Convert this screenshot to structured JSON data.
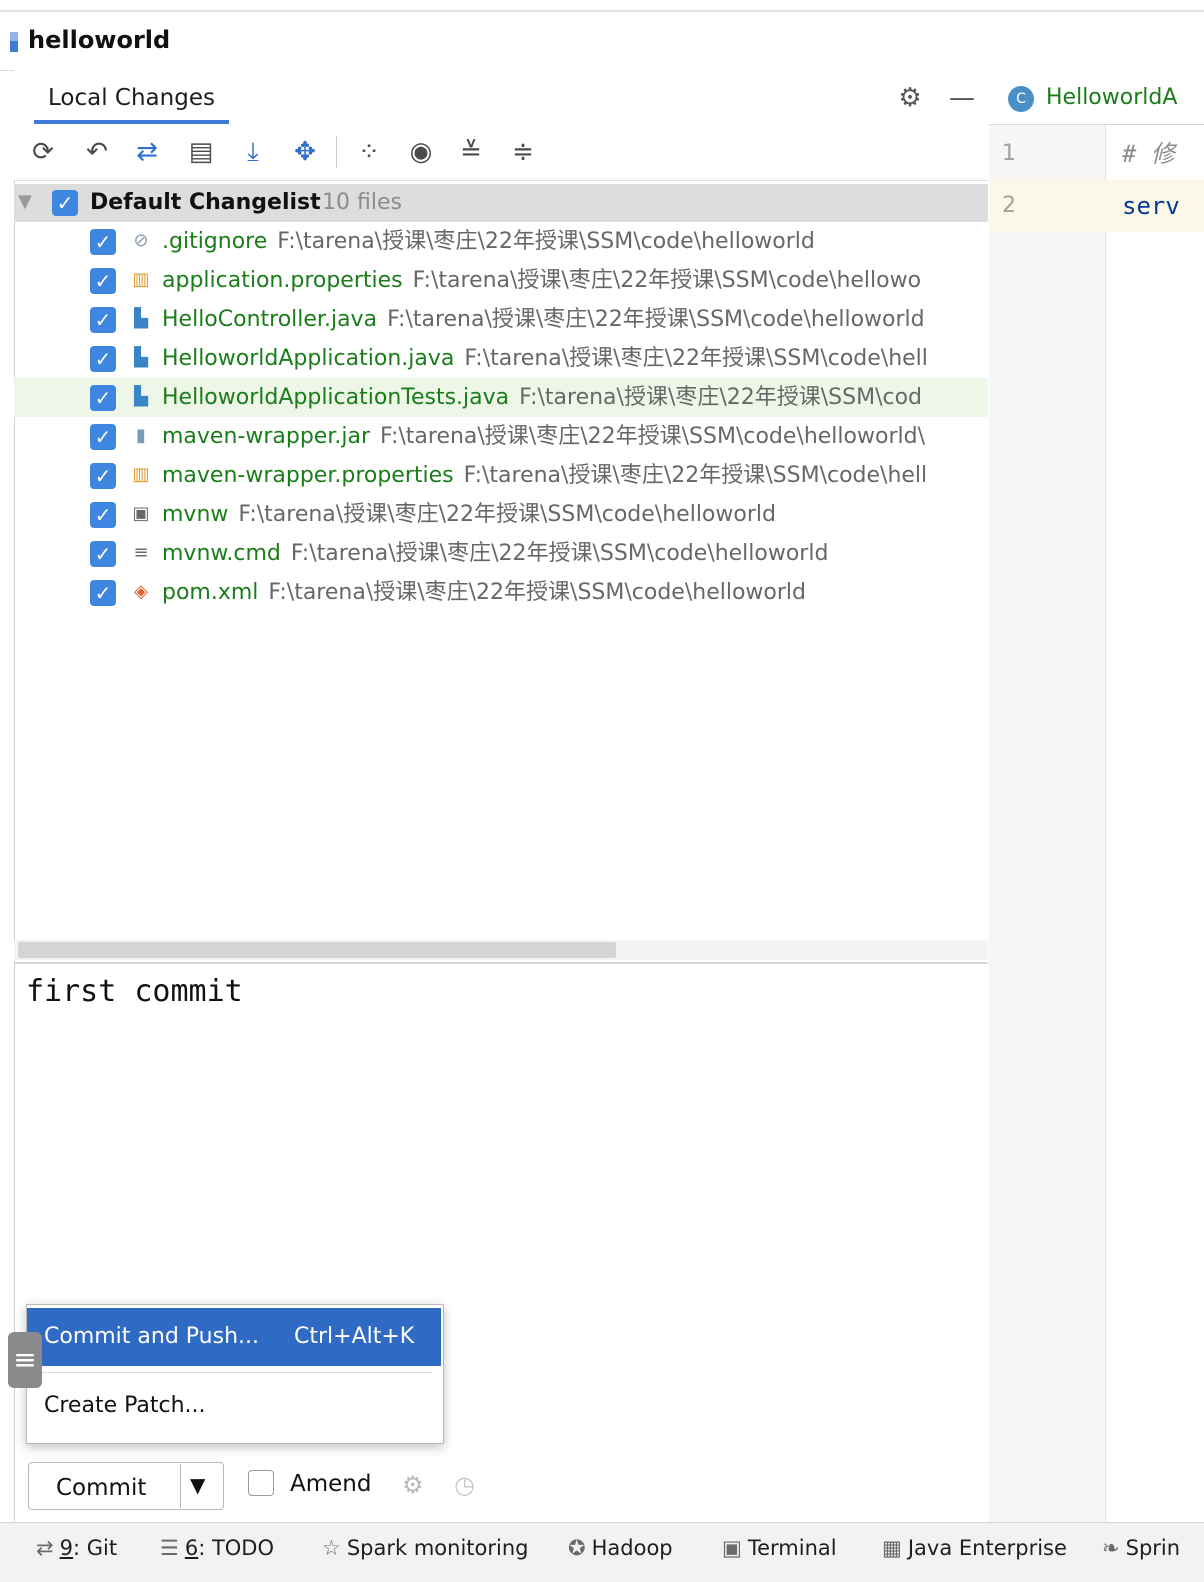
{
  "project": {
    "title": "helloworld"
  },
  "tabs": {
    "local_changes": "Local Changes"
  },
  "toolbar": {
    "icons": [
      "refresh-icon",
      "rollback-icon",
      "show-diff-icon",
      "commit-log-icon",
      "update-icon",
      "shelve-icon",
      "group-by-icon",
      "view-options-icon",
      "expand-all-icon",
      "collapse-all-icon"
    ]
  },
  "changelist": {
    "name": "Default Changelist",
    "count": "10 files",
    "checked": true
  },
  "files": [
    {
      "name": ".gitignore",
      "path": "F:\\tarena\\授课\\枣庄\\22年授课\\SSM\\code\\helloworld",
      "icon": "ignore-file-icon"
    },
    {
      "name": "application.properties",
      "path": "F:\\tarena\\授课\\枣庄\\22年授课\\SSM\\code\\hellowo",
      "icon": "properties-file-icon"
    },
    {
      "name": "HelloController.java",
      "path": "F:\\tarena\\授课\\枣庄\\22年授课\\SSM\\code\\helloworld",
      "icon": "java-file-icon"
    },
    {
      "name": "HelloworldApplication.java",
      "path": "F:\\tarena\\授课\\枣庄\\22年授课\\SSM\\code\\hell",
      "icon": "java-file-icon"
    },
    {
      "name": "HelloworldApplicationTests.java",
      "path": "F:\\tarena\\授课\\枣庄\\22年授课\\SSM\\cod",
      "icon": "java-file-icon"
    },
    {
      "name": "maven-wrapper.jar",
      "path": "F:\\tarena\\授课\\枣庄\\22年授课\\SSM\\code\\helloworld\\",
      "icon": "jar-file-icon"
    },
    {
      "name": "maven-wrapper.properties",
      "path": "F:\\tarena\\授课\\枣庄\\22年授课\\SSM\\code\\hell",
      "icon": "properties-file-icon"
    },
    {
      "name": "mvnw",
      "path": "F:\\tarena\\授课\\枣庄\\22年授课\\SSM\\code\\helloworld",
      "icon": "shell-file-icon"
    },
    {
      "name": "mvnw.cmd",
      "path": "F:\\tarena\\授课\\枣庄\\22年授课\\SSM\\code\\helloworld",
      "icon": "text-file-icon"
    },
    {
      "name": "pom.xml",
      "path": "F:\\tarena\\授课\\枣庄\\22年授课\\SSM\\code\\helloworld",
      "icon": "xml-file-icon"
    }
  ],
  "commit_message": "first commit",
  "popup_menu": {
    "commit_and_push": "Commit and Push...",
    "commit_and_push_shortcut": "Ctrl+Alt+K",
    "create_patch": "Create Patch..."
  },
  "commit_controls": {
    "commit_label": "Commit",
    "amend_label": "Amend",
    "amend_checked": false
  },
  "editor": {
    "tab_label": "HelloworldA",
    "lines": [
      {
        "number": "1",
        "text": "# 修"
      },
      {
        "number": "2",
        "text": "serv"
      }
    ]
  },
  "statusbar": {
    "git": {
      "num": "9",
      "label": ": Git"
    },
    "todo": {
      "num": "6",
      "label": ": TODO"
    },
    "spark": "Spark monitoring",
    "hadoop": "Hadoop",
    "terminal": "Terminal",
    "java_enterprise": "Java Enterprise",
    "spring": "Sprin"
  },
  "colors": {
    "accent": "#2f6bc4",
    "added_file": "#1a7d1a",
    "checkbox": "#3e86e0"
  }
}
